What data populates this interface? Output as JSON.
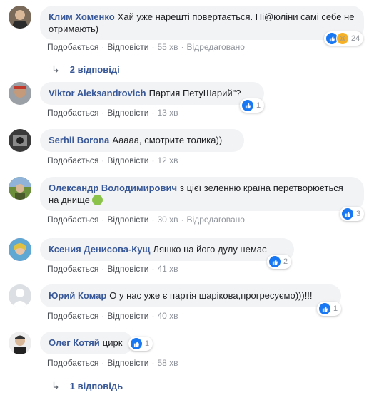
{
  "comments": [
    {
      "name": "Клим Хоменко",
      "text": "Хай уже нарешті повертається. Пі@юліни самі себе не отримають)",
      "like": "Подобається",
      "reply": "Відповісти",
      "time": "55 хв",
      "edited": "Відредаговано",
      "reactions": "24",
      "replies": "2 відповіді"
    },
    {
      "name": "Viktor Aleksandrovich",
      "text": "Партия ПетуШарий\"?",
      "like": "Подобається",
      "reply": "Відповісти",
      "time": "13 хв",
      "reactions": "1"
    },
    {
      "name": "Serhii Borona",
      "text": "Ааааа, смотрите толика))",
      "like": "Подобається",
      "reply": "Відповісти",
      "time": "12 хв"
    },
    {
      "name": "Олександр Володимирович",
      "text": "з цієї зеленню країна перетворюється на днище",
      "like": "Подобається",
      "reply": "Відповісти",
      "time": "30 хв",
      "edited": "Відредаговано",
      "reactions": "3"
    },
    {
      "name": "Ксения Денисова-Кущ",
      "text": "Ляшко на його дулу немає",
      "like": "Подобається",
      "reply": "Відповісти",
      "time": "41 хв",
      "reactions": "2"
    },
    {
      "name": "Юрий Комар",
      "text": "О у нас уже є партія шарікова,прогресуємо)))!!!",
      "like": "Подобається",
      "reply": "Відповісти",
      "time": "40 хв",
      "reactions": "1"
    },
    {
      "name": "Олег Котяй",
      "text": "цирк",
      "like": "Подобається",
      "reply": "Відповісти",
      "time": "58 хв",
      "reactions": "1",
      "replies": "1 відповідь"
    }
  ],
  "colors": {
    "name": "#385898",
    "bubble": "#f2f3f5",
    "like": "#1877f2",
    "meta": "#90949c"
  }
}
